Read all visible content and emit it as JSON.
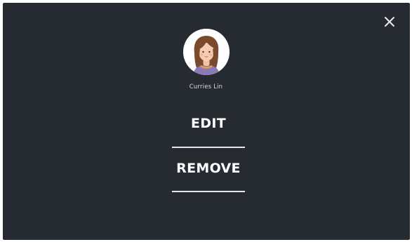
{
  "dialog": {
    "close_icon": "close-icon",
    "user": {
      "name": "Curries Lin",
      "avatar_icon": "user-avatar-illustration"
    },
    "actions": [
      {
        "label": "EDIT"
      },
      {
        "label": "REMOVE"
      }
    ],
    "colors": {
      "background": "#262a31",
      "text": "#ffffff",
      "divider": "#e6e7e9"
    }
  }
}
